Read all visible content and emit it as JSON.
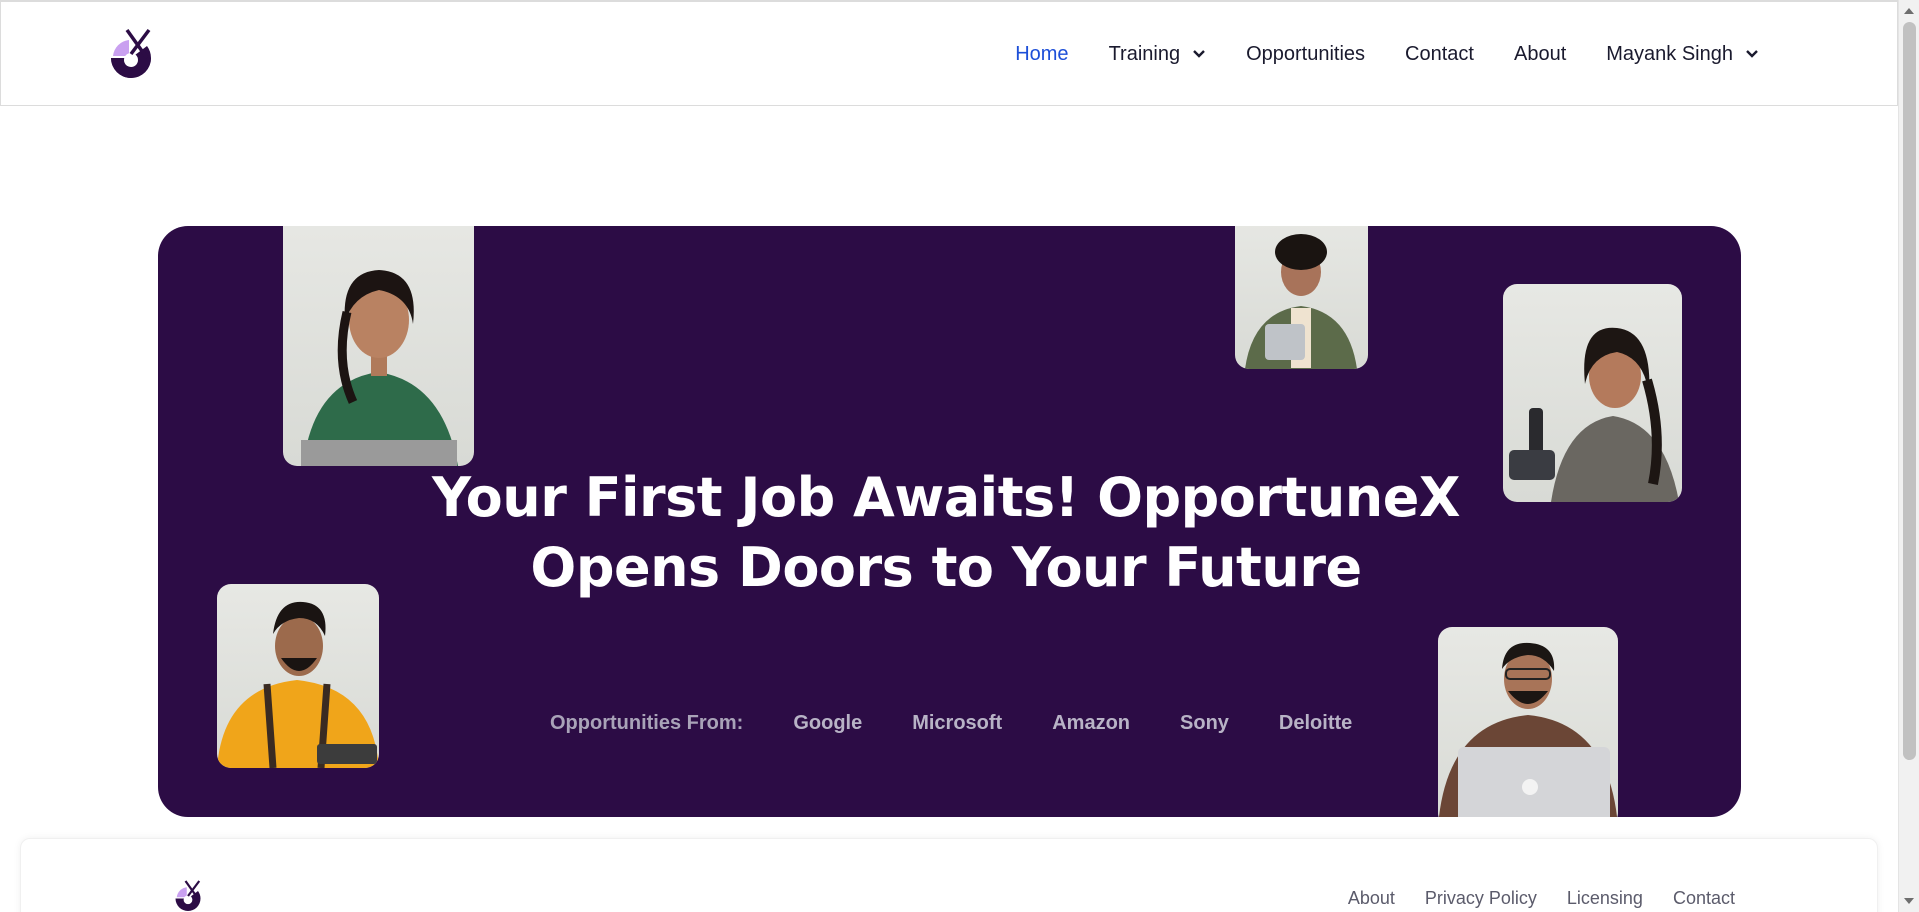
{
  "brand": {
    "name": "OpportuneX",
    "accent": "#2c0c45",
    "logo_accent": "#c9a0f0"
  },
  "nav": {
    "home": "Home",
    "training": "Training",
    "opportunities": "Opportunities",
    "contact": "Contact",
    "about": "About",
    "user": "Mayank Singh",
    "active_color": "#1d4fd8"
  },
  "hero": {
    "headline_line1": "Your First Job Awaits! OpportuneX",
    "headline_line2": "Opens Doors to Your Future",
    "companies_label": "Opportunities From:",
    "companies": [
      "Google",
      "Microsoft",
      "Amazon",
      "Sony",
      "Deloitte"
    ],
    "background": "#2c0c45"
  },
  "footer": {
    "links": [
      "About",
      "Privacy Policy",
      "Licensing",
      "Contact"
    ]
  }
}
